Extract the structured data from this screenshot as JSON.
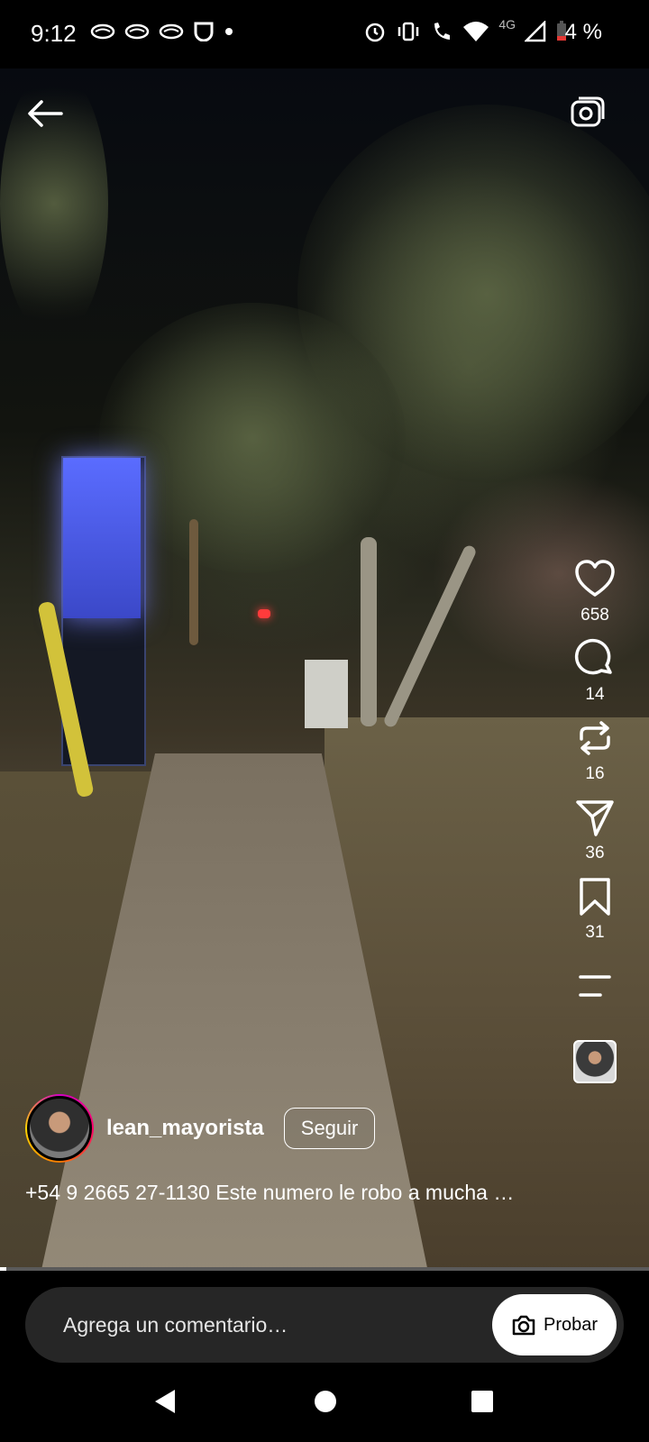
{
  "status_bar": {
    "time": "9:12",
    "battery_percent": "4 %",
    "network_label": "4G",
    "left_icons": [
      "cloud-icon",
      "cloud-icon",
      "cloud-icon",
      "notification-icon",
      "dot-icon"
    ],
    "right_icons": [
      "alarm-icon",
      "vibrate-icon",
      "wifi-call-icon",
      "wifi-icon",
      "signal-icon",
      "battery-icon"
    ]
  },
  "top_bar": {
    "back_icon": "arrow-left-icon",
    "camera_icon": "camera-icon"
  },
  "actions": {
    "likes": "658",
    "comments": "14",
    "reposts": "16",
    "shares": "36",
    "saves": "31"
  },
  "profile": {
    "username": "lean_mayorista",
    "follow_label": "Seguir"
  },
  "caption": "+54 9 2665 27-1130 Este numero le robo a mucha …",
  "video_progress": 0.01,
  "comment_bar": {
    "placeholder": "Agrega un comentario…",
    "try_label": "Probar"
  },
  "nav": {
    "back_icon": "triangle-back-icon",
    "home_icon": "circle-home-icon",
    "recents_icon": "square-recents-icon"
  },
  "colors": {
    "background": "#000000",
    "comment_bar": "#262626",
    "story_ring": [
      "#d300c5",
      "#ff0069",
      "#ff7a00",
      "#ffd600"
    ]
  }
}
